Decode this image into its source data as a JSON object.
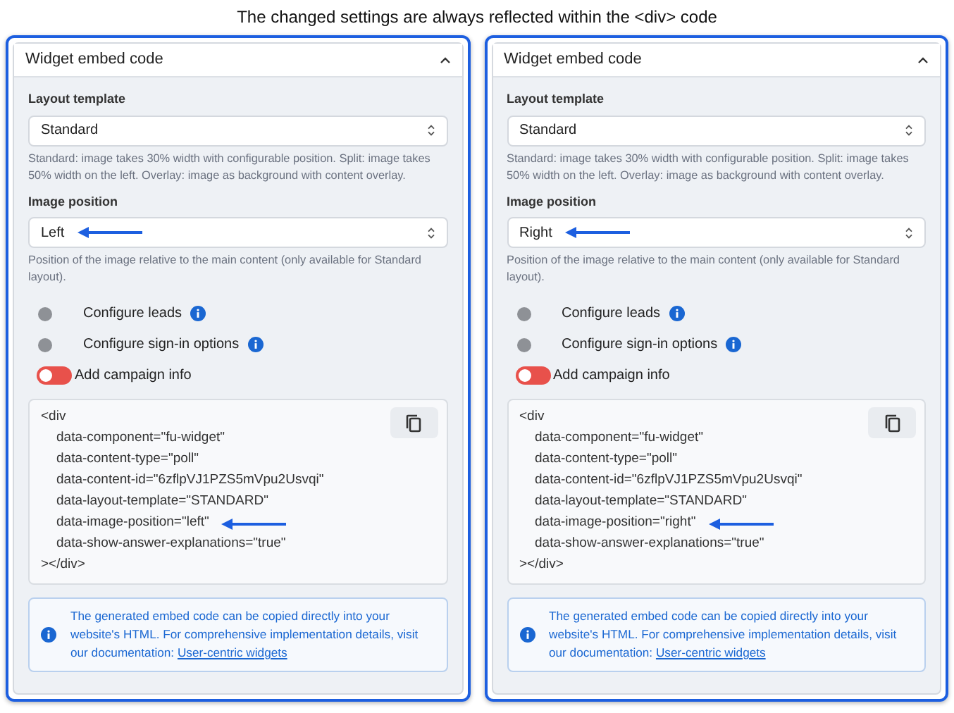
{
  "caption": "The changed settings are always reflected within the <div> code",
  "panels": [
    {
      "title": "Widget embed code",
      "expanded": true,
      "fields": [
        {
          "label": "Layout template",
          "value": "Standard",
          "arrow": false,
          "help": "Standard: image takes 30% width with configurable position. Split: image takes 50% width on the left. Overlay: image as background with content overlay."
        },
        {
          "label": "Image position",
          "value": "Left",
          "arrow": true,
          "help": "Position of the image relative to the main content (only available for Standard layout)."
        }
      ],
      "options": [
        {
          "kind": "dot",
          "label": "Configure leads",
          "info": true
        },
        {
          "kind": "dot",
          "label": "Configure sign-in options",
          "info": true
        },
        {
          "kind": "switch",
          "label": "Add campaign info",
          "info": false,
          "on": false
        }
      ],
      "code": [
        {
          "kind": "tag",
          "text": "<div",
          "arrow": false
        },
        {
          "kind": "attr",
          "text": "data-component=\"fu-widget\"",
          "arrow": false
        },
        {
          "kind": "attr",
          "text": "data-content-type=\"poll\"",
          "arrow": false
        },
        {
          "kind": "attr",
          "text": "data-content-id=\"6zflpVJ1PZS5mVpu2Usvqi\"",
          "arrow": false
        },
        {
          "kind": "attr",
          "text": "data-layout-template=\"STANDARD\"",
          "arrow": false
        },
        {
          "kind": "attr",
          "text": "data-image-position=\"left\"",
          "arrow": true
        },
        {
          "kind": "attr",
          "text": "data-show-answer-explanations=\"true\"",
          "arrow": false
        },
        {
          "kind": "tag",
          "text": "></div>",
          "arrow": false
        }
      ],
      "note": {
        "text": "The generated embed code can be copied directly into your website's HTML. For comprehensive implementation details, visit our documentation:",
        "link": "User-centric widgets"
      }
    },
    {
      "title": "Widget embed code",
      "expanded": true,
      "fields": [
        {
          "label": "Layout template",
          "value": "Standard",
          "arrow": false,
          "help": "Standard: image takes 30% width with configurable position. Split: image takes 50% width on the left. Overlay: image as background with content overlay."
        },
        {
          "label": "Image position",
          "value": "Right",
          "arrow": true,
          "help": "Position of the image relative to the main content (only available for Standard layout)."
        }
      ],
      "options": [
        {
          "kind": "dot",
          "label": "Configure leads",
          "info": true
        },
        {
          "kind": "dot",
          "label": "Configure sign-in options",
          "info": true
        },
        {
          "kind": "switch",
          "label": "Add campaign info",
          "info": false,
          "on": false
        }
      ],
      "code": [
        {
          "kind": "tag",
          "text": "<div",
          "arrow": false
        },
        {
          "kind": "attr",
          "text": "data-component=\"fu-widget\"",
          "arrow": false
        },
        {
          "kind": "attr",
          "text": "data-content-type=\"poll\"",
          "arrow": false
        },
        {
          "kind": "attr",
          "text": "data-content-id=\"6zflpVJ1PZS5mVpu2Usvqi\"",
          "arrow": false
        },
        {
          "kind": "attr",
          "text": "data-layout-template=\"STANDARD\"",
          "arrow": false
        },
        {
          "kind": "attr",
          "text": "data-image-position=\"right\"",
          "arrow": true
        },
        {
          "kind": "attr",
          "text": "data-show-answer-explanations=\"true\"",
          "arrow": false
        },
        {
          "kind": "tag",
          "text": "></div>",
          "arrow": false
        }
      ],
      "note": {
        "text": "The generated embed code can be copied directly into your website's HTML. For comprehensive implementation details, visit our documentation:",
        "link": "User-centric widgets"
      }
    }
  ]
}
